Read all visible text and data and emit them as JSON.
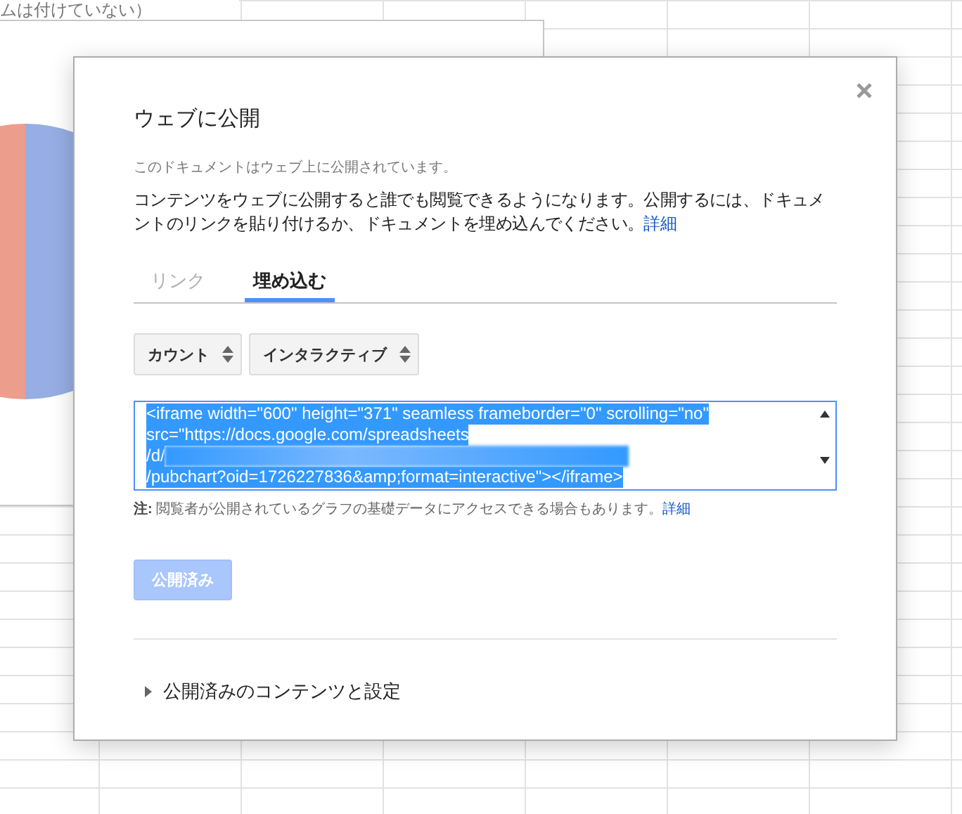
{
  "background": {
    "heading": "ムは付けていない）"
  },
  "dialog": {
    "title": "ウェブに公開",
    "status": "このドキュメントはウェブ上に公開されています。",
    "description": "コンテンツをウェブに公開すると誰でも閲覧できるようになります。公開するには、ドキュメントのリンクを貼り付けるか、ドキュメントを埋め込んでください。",
    "description_link": "詳細",
    "tabs": [
      {
        "label": "リンク",
        "selected": false
      },
      {
        "label": "埋め込む",
        "selected": true
      }
    ],
    "selects": [
      {
        "value": "カウント"
      },
      {
        "value": "インタラクティブ"
      }
    ],
    "embed_code": {
      "selected": true,
      "lines": [
        {
          "text": "<iframe width=\"600\" height=\"371\" seamless frameborder=\"0\" scrolling=\"no\"",
          "redacted": false
        },
        {
          "text": "src=\"https://docs.google.com/spreadsheets",
          "redacted": false
        },
        {
          "text": "/d/",
          "redacted": true
        },
        {
          "text": "/pubchart?oid=1726227836&amp;format=interactive\"></iframe>",
          "redacted": false
        }
      ]
    },
    "note": "**注:** 閲覧者が公開されているグラフの基礎データにアクセスできる場合もあります。",
    "note_link": "詳細",
    "publish_button": {
      "label": "公開済み",
      "disabled": true
    },
    "published_section": {
      "label": "公開済みのコンテンツと設定",
      "expanded": false
    }
  }
}
